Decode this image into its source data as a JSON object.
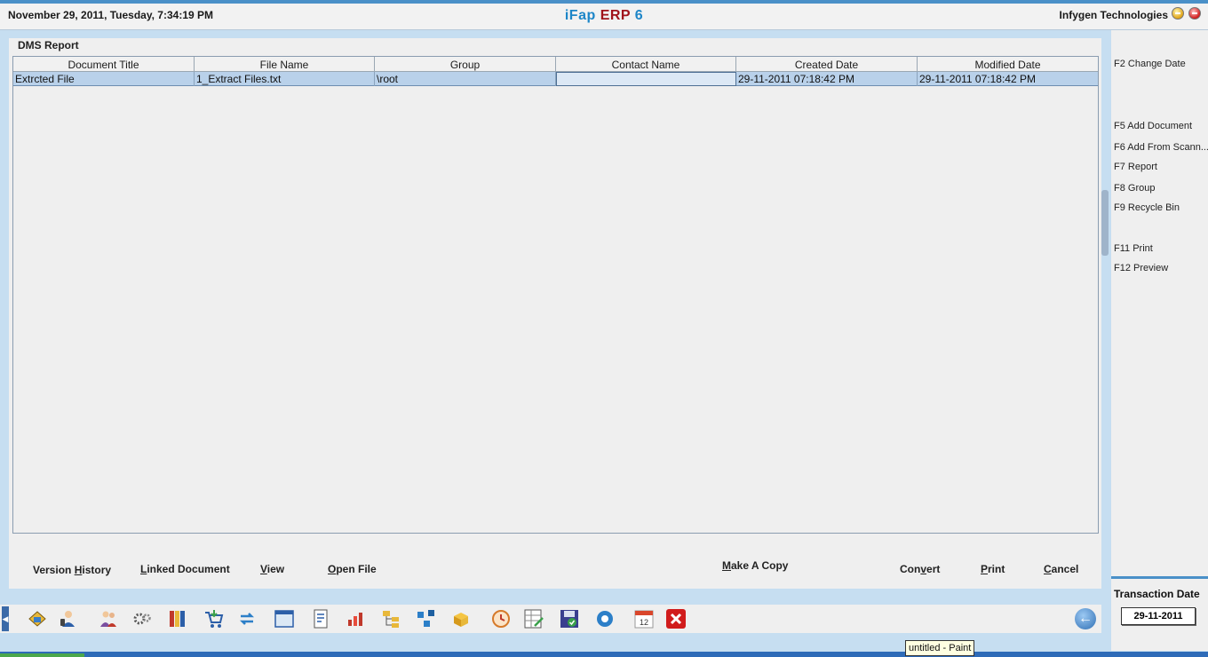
{
  "header": {
    "datetime": "November  29, 2011, Tuesday, 7:34:19 PM",
    "title_part1": "iFap",
    "title_part2": "ERP",
    "title_part3": "6",
    "company": "Infygen Technologies"
  },
  "panel": {
    "title": "DMS Report"
  },
  "table": {
    "columns": [
      "Document Title",
      "File Name",
      "Group",
      "Contact Name",
      "Created Date",
      "Modified Date"
    ],
    "rows": [
      [
        "Extrcted File",
        "1_Extract Files.txt",
        "\\root",
        "",
        "29-11-2011 07:18:42 PM",
        "29-11-2011 07:18:42 PM"
      ]
    ]
  },
  "actions": {
    "version_history_a": "Version ",
    "version_history_u": "H",
    "version_history_b": "istory",
    "linked_u": "L",
    "linked_b": "inked Document",
    "view_u": "V",
    "view_b": "iew",
    "open_u": "O",
    "open_b": "pen File",
    "copy_u": "M",
    "copy_b": "ake A Copy",
    "convert_a": "Con",
    "convert_u": "v",
    "convert_b": "ert",
    "print_u": "P",
    "print_b": "rint",
    "cancel_u": "C",
    "cancel_b": "ancel"
  },
  "sidebar": {
    "items": [
      "F2 Change Date",
      "F5 Add Document",
      "F6 Add From Scann...",
      "F7 Report",
      "F8 Group",
      "F9 Recycle Bin",
      "F11 Print",
      "F12 Preview"
    ],
    "transaction_label": "Transaction Date",
    "transaction_value": "29-11-2011"
  },
  "toolbar": {
    "calendar_day": "12",
    "icons": [
      "home-icon",
      "user-phone-icon",
      "people-icon",
      "gears-icon",
      "books-icon",
      "cart-icon",
      "transfer-icon",
      "window-icon",
      "report-icon",
      "chart-icon",
      "folder-tree-icon",
      "network-icon",
      "package-icon",
      "clock-icon",
      "spreadsheet-icon",
      "save-icon",
      "settings-icon",
      "calendar-icon",
      "close-icon"
    ]
  },
  "taskbar": {
    "tooltip": "untitled - Paint"
  },
  "colors": {
    "accent": "#4a90c8",
    "title_blue": "#1d86c8",
    "title_red": "#a0131b",
    "selected_row": "#b9d1ea"
  }
}
